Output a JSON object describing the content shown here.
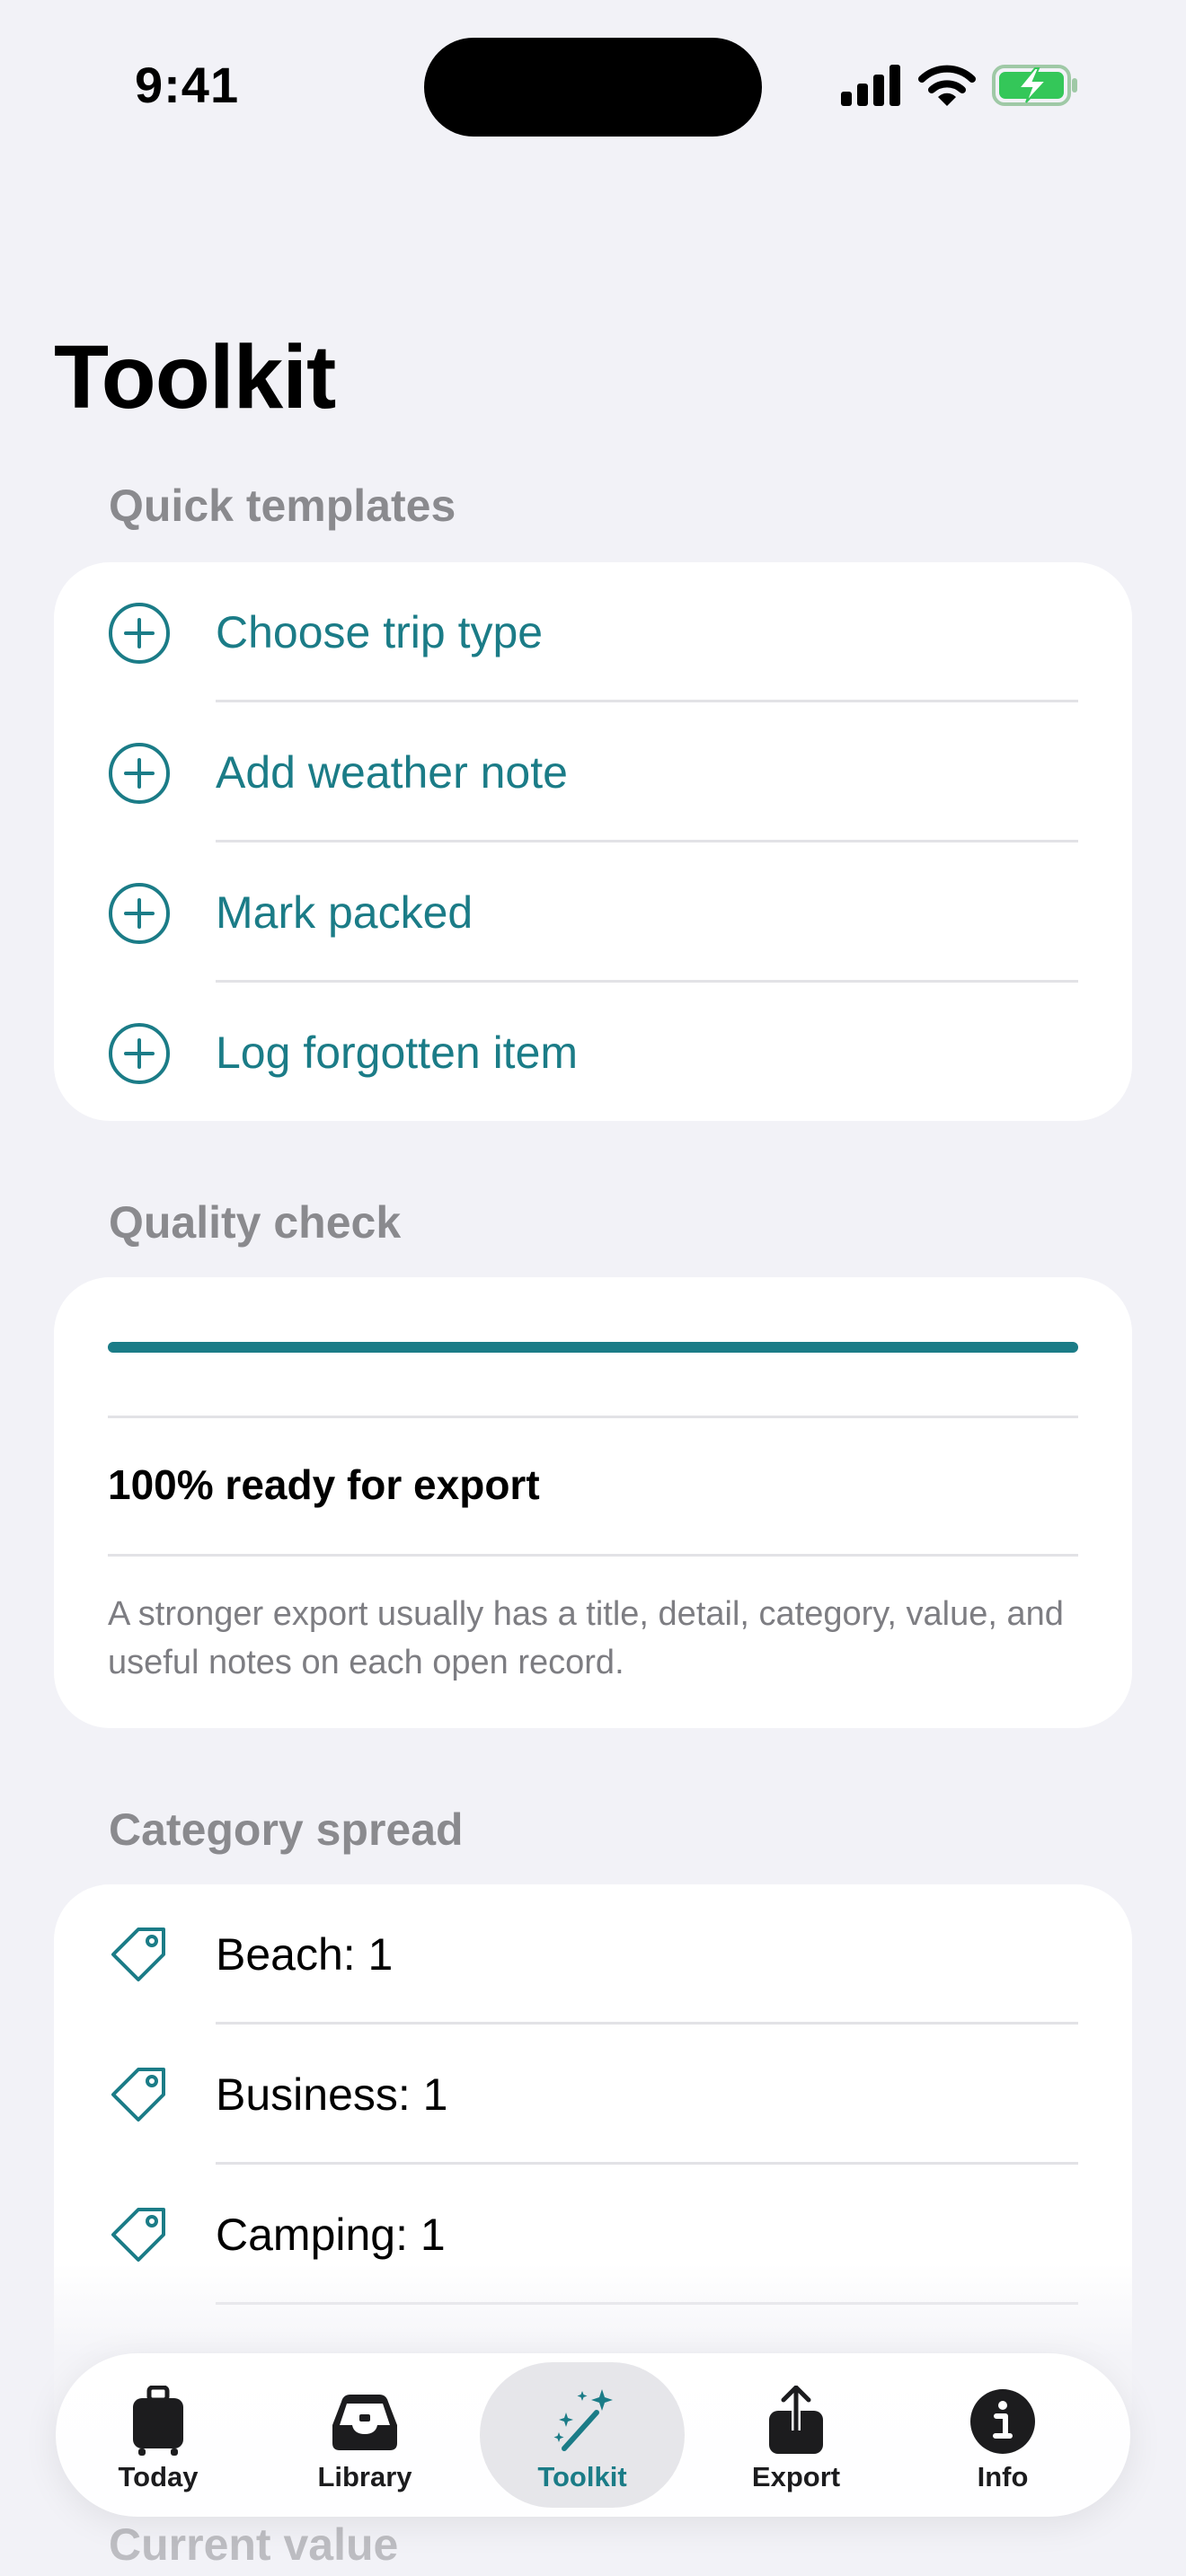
{
  "status_bar": {
    "time": "9:41"
  },
  "page": {
    "title": "Toolkit"
  },
  "quick_templates": {
    "header": "Quick templates",
    "items": [
      {
        "label": "Choose trip type",
        "icon": "plus-circle-icon"
      },
      {
        "label": "Add weather note",
        "icon": "plus-circle-icon"
      },
      {
        "label": "Mark packed",
        "icon": "plus-circle-icon"
      },
      {
        "label": "Log forgotten item",
        "icon": "plus-circle-icon"
      }
    ]
  },
  "quality_check": {
    "header": "Quality check",
    "progress": 1.0,
    "status": "100% ready for export",
    "note": "A stronger export usually has a title, detail, category, value, and useful notes on each open record."
  },
  "category_spread": {
    "header": "Category spread",
    "items": [
      {
        "label": "Beach: 1",
        "icon": "tag-icon"
      },
      {
        "label": "Business: 1",
        "icon": "tag-icon"
      },
      {
        "label": "Camping: 1",
        "icon": "tag-icon"
      }
    ]
  },
  "next_section": {
    "header": "Current value"
  },
  "tab_bar": {
    "active": "Toolkit",
    "accent": "#1b7c87",
    "tabs": [
      {
        "label": "Today",
        "icon": "suitcase-icon"
      },
      {
        "label": "Library",
        "icon": "tray-icon"
      },
      {
        "label": "Toolkit",
        "icon": "magic-wand-icon"
      },
      {
        "label": "Export",
        "icon": "share-icon"
      },
      {
        "label": "Info",
        "icon": "info-icon"
      }
    ]
  }
}
